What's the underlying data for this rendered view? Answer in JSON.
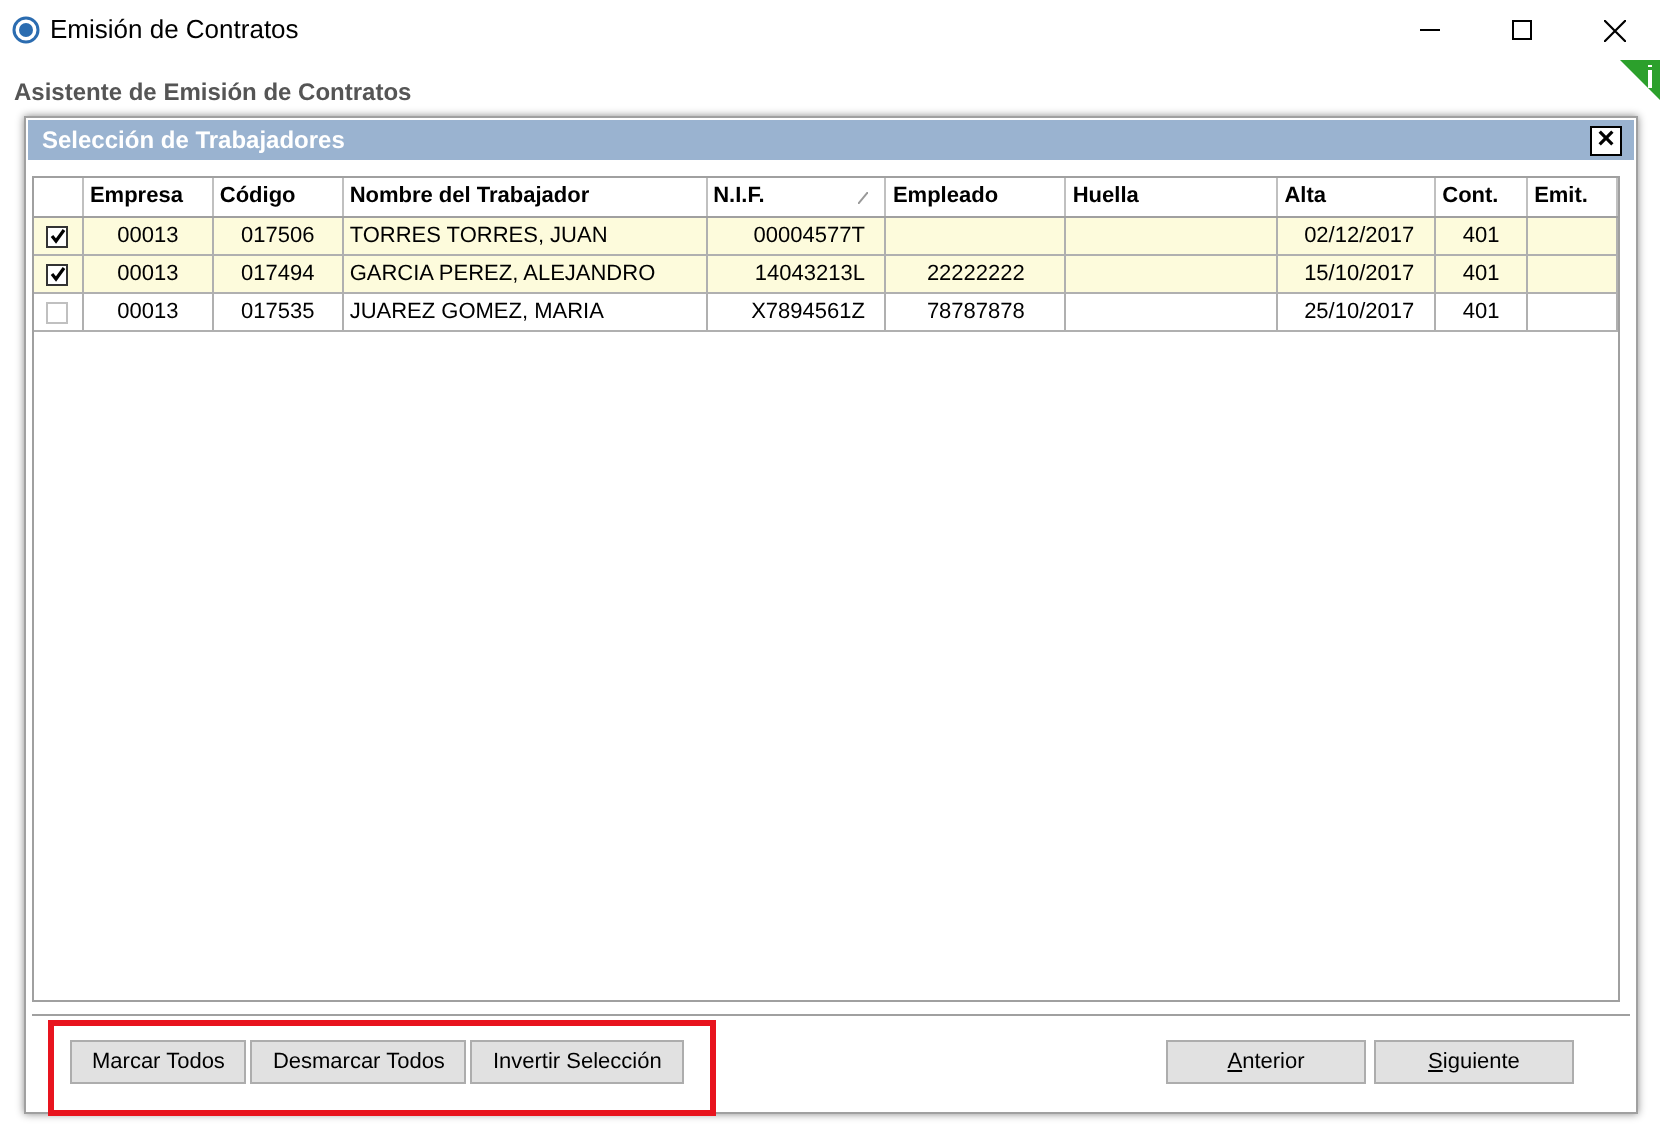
{
  "window": {
    "title": "Emisión de Contratos"
  },
  "wizard_title": "Asistente de Emisión de Contratos",
  "dialog": {
    "title": "Selección de Trabajadores",
    "close": "×"
  },
  "table": {
    "columns": [
      {
        "label": "Empresa",
        "sorted": false
      },
      {
        "label": "Código",
        "sorted": false
      },
      {
        "label": "Nombre del Trabajador",
        "sorted": false
      },
      {
        "label": "N.I.F.",
        "sorted": true
      },
      {
        "label": "Empleado",
        "sorted": false
      },
      {
        "label": "Huella",
        "sorted": false
      },
      {
        "label": "Alta",
        "sorted": false
      },
      {
        "label": "Cont.",
        "sorted": false
      },
      {
        "label": "Emit.",
        "sorted": false
      }
    ],
    "rows": [
      {
        "checked": true,
        "cells": [
          "00013",
          "017506",
          "TORRES TORRES, JUAN",
          "00004577T",
          "",
          "",
          "02/12/2017",
          "401",
          ""
        ]
      },
      {
        "checked": true,
        "cells": [
          "00013",
          "017494",
          "GARCIA PEREZ, ALEJANDRO",
          "14043213L",
          "22222222",
          "",
          "15/10/2017",
          "401",
          ""
        ]
      },
      {
        "checked": false,
        "cells": [
          "00013",
          "017535",
          "JUAREZ GOMEZ, MARIA",
          "X7894561Z",
          "78787878",
          "",
          "25/10/2017",
          "401",
          ""
        ]
      }
    ]
  },
  "selection_buttons": [
    "Marcar Todos",
    "Desmarcar Todos",
    "Invertir Selección"
  ],
  "nav_buttons": [
    "Anterior",
    "Siguiente"
  ]
}
